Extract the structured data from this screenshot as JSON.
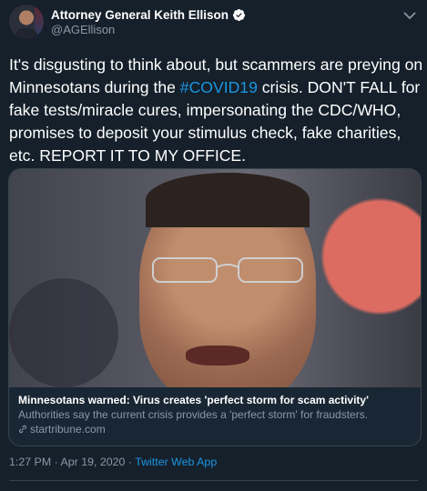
{
  "tweet": {
    "author_name": "Attorney General Keith Ellison",
    "handle": "@AGEllison",
    "text_before": "It's disgusting to think about, but scammers are preying on Minnesotans during the ",
    "hashtag": "#COVID19",
    "text_after": " crisis. DON'T FALL for fake tests/miracle cures, impersonating the CDC/WHO, promises to deposit your stimulus check, fake charities, etc. REPORT IT TO MY OFFICE.",
    "timestamp": "1:27 PM · Apr 19, 2020 · ",
    "source_app": "Twitter Web App"
  },
  "card": {
    "title": "Minnesotans warned: Virus creates 'perfect storm for scam activity'",
    "description": "Authorities say the current crisis provides a 'perfect storm' for fraudsters.",
    "domain": "startribune.com"
  },
  "colors": {
    "background": "#15202b",
    "link": "#1b95e0",
    "secondary_text": "#8899a6",
    "border": "#38444d"
  },
  "icons": [
    "verified-badge-icon",
    "chevron-down-icon",
    "link-icon"
  ]
}
